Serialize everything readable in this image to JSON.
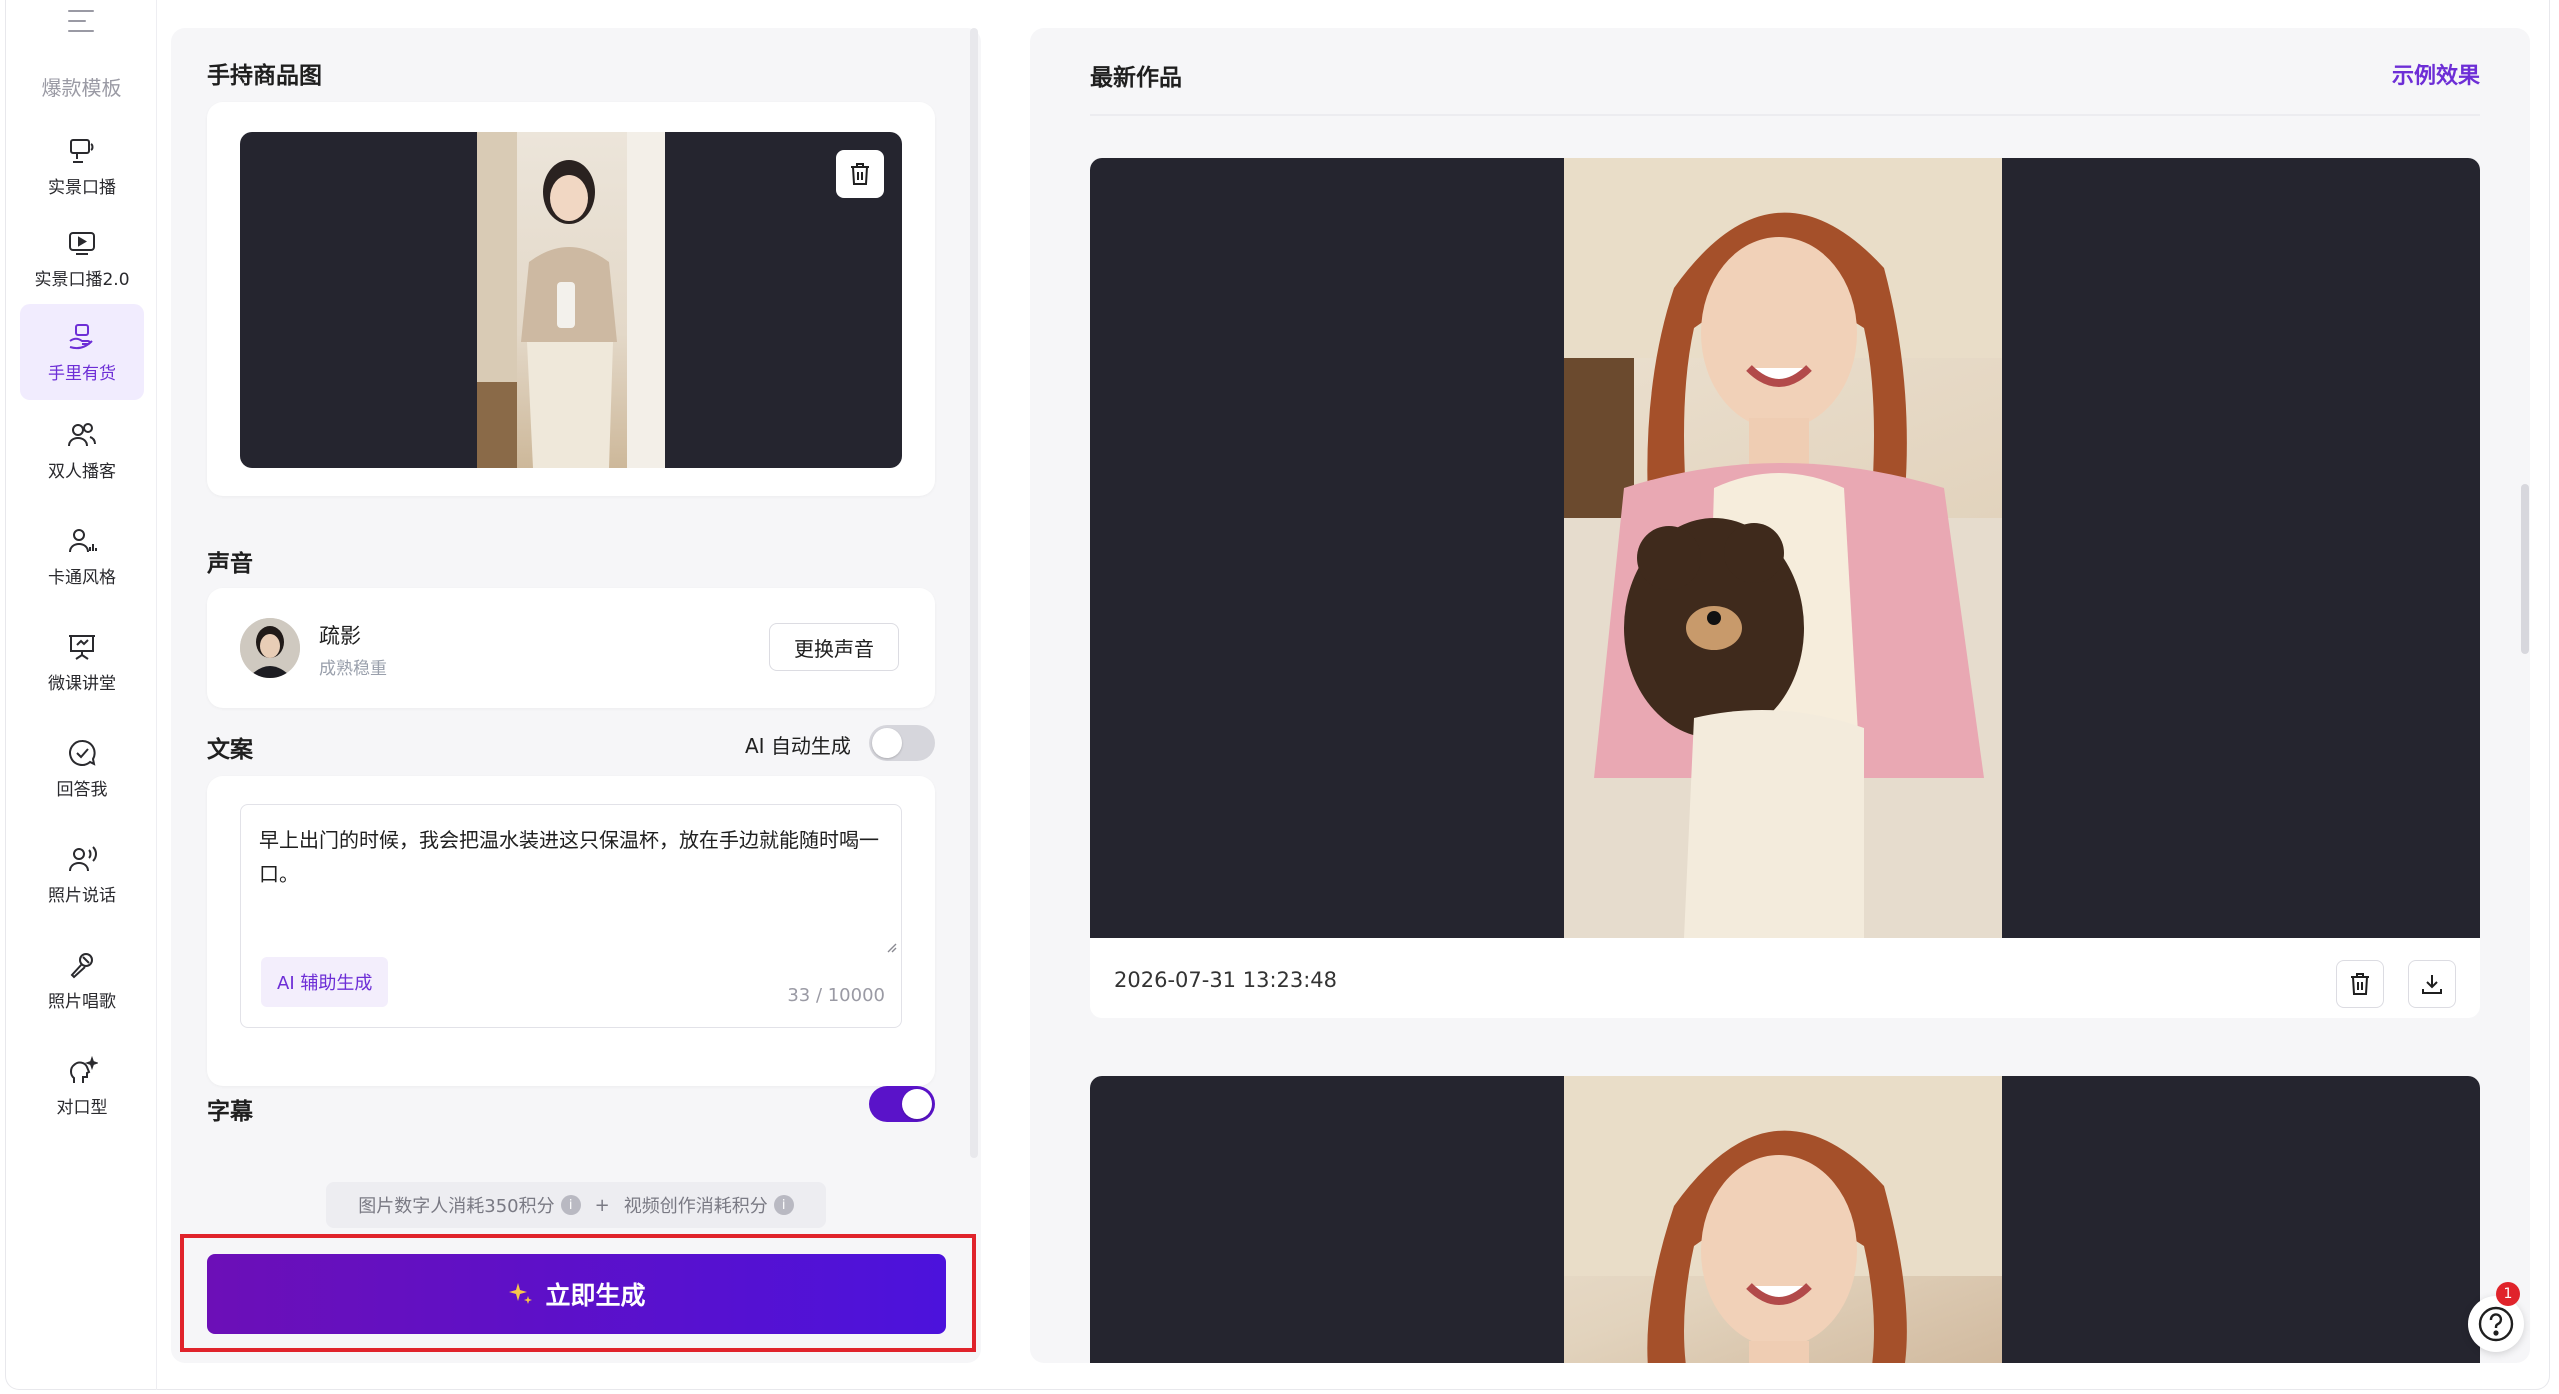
{
  "sidebar": {
    "section_label": "爆款模板",
    "items": [
      {
        "label": "实景口播",
        "icon": "talking-screen-icon"
      },
      {
        "label": "实景口播2.0",
        "icon": "play-screen-icon"
      },
      {
        "label": "手里有货",
        "icon": "hand-product-icon",
        "active": true
      },
      {
        "label": "双人播客",
        "icon": "two-people-icon"
      },
      {
        "label": "卡通风格",
        "icon": "cartoon-person-icon"
      },
      {
        "label": "微课讲堂",
        "icon": "presentation-board-icon"
      },
      {
        "label": "回答我",
        "icon": "check-bubble-icon"
      },
      {
        "label": "照片说话",
        "icon": "person-speaking-icon"
      },
      {
        "label": "照片唱歌",
        "icon": "microphone-icon"
      },
      {
        "label": "对口型",
        "icon": "lipsync-head-icon"
      }
    ]
  },
  "left": {
    "product_title": "手持商品图",
    "voice_title": "声音",
    "voice": {
      "name": "疏影",
      "desc": "成熟稳重",
      "change_label": "更换声音"
    },
    "script_title": "文案",
    "ai_auto_label": "AI 自动生成",
    "ai_auto_on": false,
    "script_text": "早上出门的时候，我会把温水装进这只保温杯，放在手边就能随时喝一口。",
    "ai_assist_label": "AI 辅助生成",
    "counter": "33 / 10000",
    "subtitle_title": "字幕",
    "subtitle_on": true,
    "cost_part1": "图片数字人消耗350积分",
    "cost_plus": "+",
    "cost_part2": "视频创作消耗积分",
    "generate_label": "立即生成"
  },
  "right": {
    "title": "最新作品",
    "example_link": "示例效果",
    "works": [
      {
        "time": "2026-07-31 13:23:48"
      },
      {
        "time": ""
      }
    ]
  },
  "help": {
    "badge": "1"
  },
  "colors": {
    "accent": "#6d2ed6",
    "button_start": "#6c0fb7",
    "button_end": "#4c12dc",
    "highlight": "#e0232b"
  }
}
